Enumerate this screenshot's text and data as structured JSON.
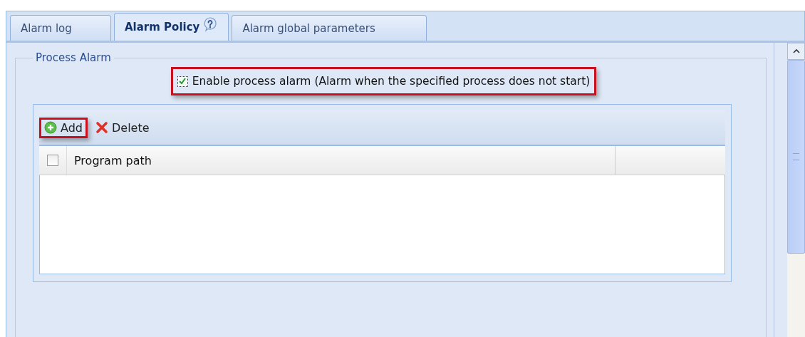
{
  "tabs": [
    {
      "label": "Alarm log",
      "selected": false,
      "help": false
    },
    {
      "label": "Alarm Policy",
      "selected": true,
      "help": true
    },
    {
      "label": "Alarm global parameters",
      "selected": false,
      "help": false
    }
  ],
  "fieldset": {
    "legend": "Process Alarm",
    "enable": {
      "label": "Enable process alarm (Alarm when the specified process does not start)",
      "checked": true,
      "highlighted": true
    }
  },
  "toolbar": [
    {
      "kind": "add",
      "label": "Add",
      "highlighted": true
    },
    {
      "kind": "delete",
      "label": "Delete",
      "highlighted": false
    }
  ],
  "table": {
    "select_all_checked": false,
    "columns": [
      "Program path"
    ]
  }
}
